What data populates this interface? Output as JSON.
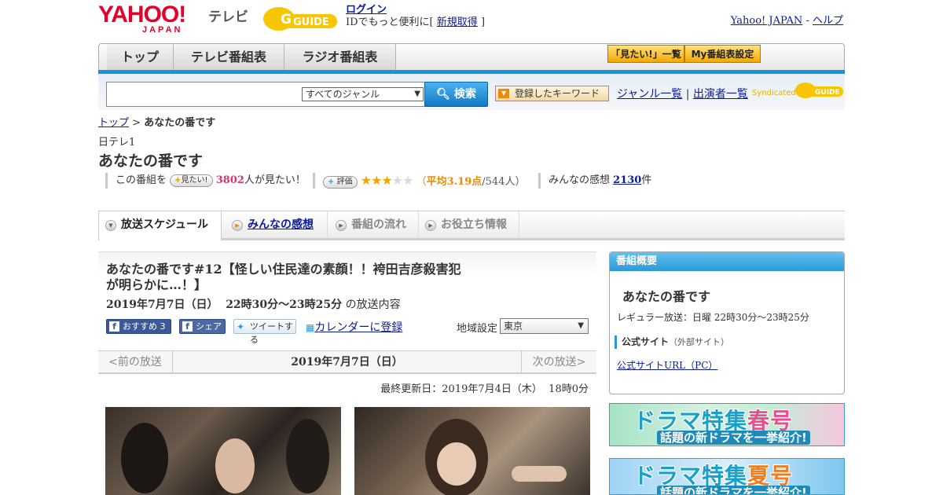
{
  "header": {
    "yahoo_logo": "YAHOO!",
    "yahoo_sub": "JAPAN",
    "tv_label": "テレビ",
    "gguide_logo": "GUIDE",
    "login_link": "ログイン",
    "id_prompt_prefix": "IDでもっと便利に[",
    "signup_link": "新規取得",
    "id_prompt_suffix": "]",
    "yahoo_japan_link": "Yahoo! JAPAN",
    "separator": " - ",
    "help_link": "ヘルプ"
  },
  "nav": {
    "tabs": [
      {
        "label": "トップ"
      },
      {
        "label": "テレビ番組表"
      },
      {
        "label": "ラジオ番組表"
      }
    ],
    "want_list_button": "「見たい!」一覧",
    "my_schedule_button": "My番組表設定"
  },
  "search": {
    "input_value": "",
    "genre_select": "すべてのジャンル",
    "search_button": "検索",
    "keyword_button": "登録したキーワード",
    "genre_list_link": "ジャンル一覧",
    "performer_list_link": "出演者一覧",
    "syndicated_label": "Syndicated",
    "syndicated_logo": "GUIDE"
  },
  "breadcrumb": {
    "top_link": "トップ",
    "separator": ">",
    "current": "あなたの番です"
  },
  "program": {
    "channel": "日テレ1",
    "title": "あなたの番です",
    "want_prefix": "この番組を",
    "want_button": "見たい!",
    "want_count": "3802",
    "want_suffix": "人が見たい！",
    "rate_button": "評価",
    "rating_value": 3,
    "rating_max": 5,
    "rating_open": "（",
    "rating_avg": "平均3.19点",
    "rating_count": "/544人）",
    "impressions_prefix": "みんなの感想",
    "impressions_count": "2130",
    "impressions_suffix": "件"
  },
  "tabs": [
    {
      "label": "放送スケジュール"
    },
    {
      "label": "みんなの感想"
    },
    {
      "label": "番組の流れ"
    },
    {
      "label": "お役立ち情報"
    }
  ],
  "episode": {
    "title": "あなたの番です#12【怪しい住民達の素顔！！袴田吉彦殺害犯が明らかに…！】",
    "date_time": "2019年7月7日（日）  22時30分～23時25分",
    "date_suffix": "の放送内容",
    "fb_recommend": "おすすめ 3",
    "fb_share": "シェア",
    "tweet": "ツイートする",
    "calendar_link": "カレンダーに登録",
    "region_label": "地域設定",
    "region_value": "東京",
    "prev_broadcast": "<前の放送",
    "pager_date": "2019年7月7日（日）",
    "next_broadcast": "次の放送>",
    "last_updated": "最終更新日：2019年7月4日（木）  18時0分"
  },
  "overview": {
    "header": "番組概要",
    "title": "あなたの番です",
    "regular": "レギュラー放送：日曜 22時30分～23時25分",
    "official_label": "公式サイト",
    "official_note": "（外部サイト）",
    "official_url": "公式サイトURL（PC）"
  },
  "banners": [
    {
      "prefix": "ドラマ特集",
      "season": "春号",
      "sub": "話題の新ドラマを一挙紹介!"
    },
    {
      "prefix": "ドラマ特集",
      "season": "夏号",
      "sub": "話題の新ドラマを一挙紹介!"
    }
  ],
  "colors": {
    "accent_blue": "#1a93d6",
    "yahoo_red": "#e4002b",
    "star": "#f0a500",
    "want_count": "#d8336f"
  }
}
